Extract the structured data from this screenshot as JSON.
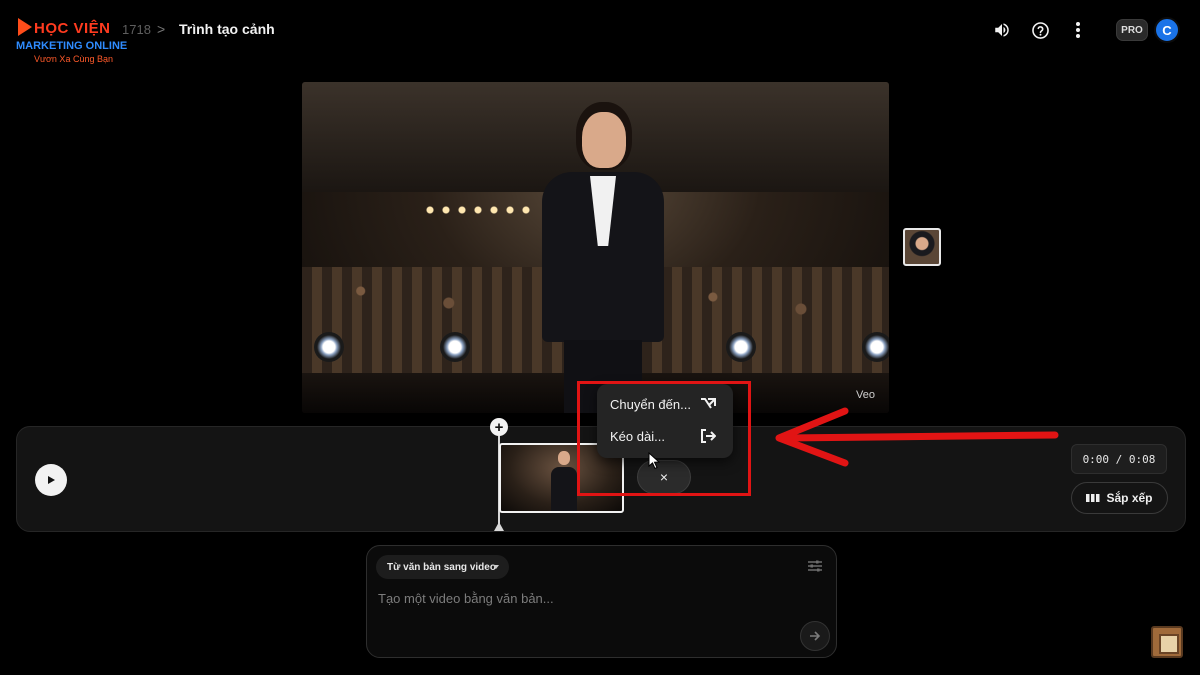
{
  "header": {
    "logo": {
      "brand": "HỌC VIỆN",
      "tagline": "MARKETING ONLINE",
      "slogan": "Vươn Xa Cùng Bạn"
    },
    "breadcrumb": {
      "project_id": "1718",
      "separator": ">",
      "title": "Trình tạo cảnh"
    },
    "icons": [
      "volume-icon",
      "help-icon",
      "more-vert-icon"
    ],
    "pro_badge": "PRO",
    "avatar_initial": "C"
  },
  "preview": {
    "watermark": "Veo"
  },
  "context_menu": {
    "items": [
      {
        "label": "Chuyển đến...",
        "icon": "jump-arrow-icon"
      },
      {
        "label": "Kéo dài...",
        "icon": "extend-exit-icon"
      }
    ]
  },
  "timeline": {
    "add_label": "+",
    "close_label": "×",
    "time_readout": "0:00 / 0:08",
    "arrange_label": "Sắp xếp"
  },
  "prompt": {
    "mode": "Từ văn bản sang video",
    "placeholder": "Tạo một video bằng văn bản..."
  },
  "colors": {
    "annotation": "#e11414",
    "avatar": "#1a73e8",
    "background": "#000000"
  }
}
